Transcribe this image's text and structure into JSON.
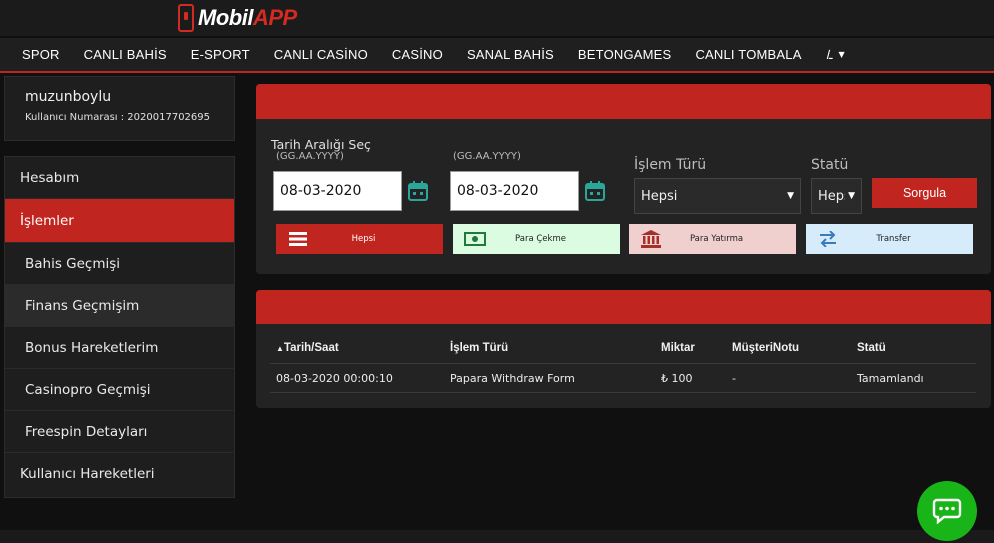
{
  "brand": {
    "part1": "Mobil",
    "part2": "APP"
  },
  "colors": {
    "accent": "#c1251f",
    "chat": "#18b418"
  },
  "nav": {
    "items": [
      "SPOR",
      "CANLI BAHİS",
      "E-SPORT",
      "CANLI CASİNO",
      "CASİNO",
      "SANAL BAHİS",
      "BETONGAMES",
      "CANLI TOMBALA"
    ],
    "lang": "ـﺍ"
  },
  "user": {
    "name": "muzunboylu",
    "number": "Kullanıcı Numarası : 2020017702695"
  },
  "sidebar": {
    "items": [
      {
        "label": "Hesabım",
        "type": "main",
        "state": ""
      },
      {
        "label": "İşlemler",
        "type": "main",
        "state": "active"
      },
      {
        "label": "Bahis Geçmişi",
        "type": "sub",
        "state": ""
      },
      {
        "label": "Finans Geçmişim",
        "type": "sub",
        "state": "hover"
      },
      {
        "label": "Bonus Hareketlerim",
        "type": "sub",
        "state": ""
      },
      {
        "label": "Casinopro Geçmişi",
        "type": "sub",
        "state": ""
      },
      {
        "label": "Freespin Detayları",
        "type": "sub",
        "state": ""
      },
      {
        "label": "Kullanıcı Hareketleri",
        "type": "main",
        "state": ""
      }
    ]
  },
  "filter": {
    "date_range_label": "Tarih Aralığı Seç",
    "date_format": "(GG.AA.YYYY)",
    "date_from": "08-03-2020",
    "date_to": "08-03-2020",
    "type_label": "İşlem Türü",
    "type_value": "Hepsi",
    "status_label": "Statü",
    "status_value": "Hepsi",
    "submit_label": "Sorgula"
  },
  "quick_filters": [
    {
      "label": "Hepsi",
      "icon": "menu-lines-icon",
      "bg": "#c1251f",
      "fg": "#ffffff"
    },
    {
      "label": "Para Çekme",
      "icon": "banknote-icon",
      "bg": "#dcfce1",
      "fg": "#222222"
    },
    {
      "label": "Para Yatırma",
      "icon": "bank-icon",
      "bg": "#f0cfcf",
      "fg": "#222222"
    },
    {
      "label": "Transfer",
      "icon": "transfer-arrows-icon",
      "bg": "#d6ecfb",
      "fg": "#222222"
    }
  ],
  "table": {
    "sort_indicator": "▲",
    "headers": [
      "Tarih/Saat",
      "İşlem Türü",
      "Miktar",
      "MüşteriNotu",
      "Statü"
    ],
    "rows": [
      [
        "08-03-2020 00:00:10",
        "Papara Withdraw Form",
        "₺ 100",
        "-",
        "Tamamlandı"
      ]
    ]
  },
  "chat": {
    "icon": "chat-bubble-icon"
  }
}
